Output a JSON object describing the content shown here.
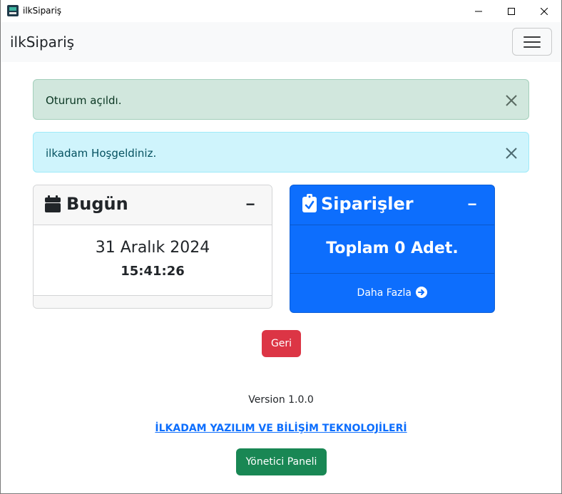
{
  "window": {
    "title": "ilkSipariş"
  },
  "navbar": {
    "brand": "ilkSipariş"
  },
  "alerts": [
    {
      "text": "Oturum açıldı.",
      "type": "success"
    },
    {
      "text": "ilkadam Hoşgeldiniz.",
      "type": "info"
    }
  ],
  "today_card": {
    "title": "Bugün",
    "collapse_symbol": "−",
    "date": "31 Aralık 2024",
    "time": "15:41:26"
  },
  "orders_card": {
    "title": "Siparişler",
    "collapse_symbol": "−",
    "total": "Toplam 0 Adet.",
    "more_label": "Daha Fazla"
  },
  "buttons": {
    "back_label": "Geri",
    "admin_label": "Yönetici Paneli"
  },
  "footer": {
    "version": "Version 1.0.0",
    "company": "İLKADAM YAZILIM VE BİLİŞİM TEKNOLOJİLERİ"
  },
  "colors": {
    "primary": "#0d6efd",
    "danger": "#dc3545",
    "success": "#198754",
    "alert_success_bg": "#d1e7dd",
    "alert_info_bg": "#cff4fc"
  },
  "icons": {
    "app": "app-logo-icon",
    "minimize": "minimize-icon",
    "maximize": "maximize-icon",
    "close": "close-icon",
    "menu": "hamburger-menu-icon",
    "alert_close": "close-icon",
    "calendar": "calendar-icon",
    "clipboard": "clipboard-check-icon",
    "arrow": "arrow-right-circle-icon"
  }
}
